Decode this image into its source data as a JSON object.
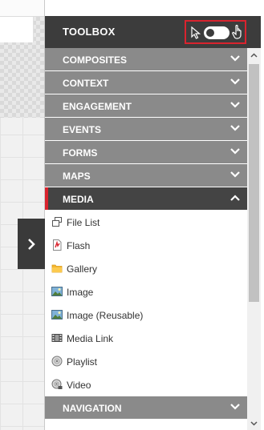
{
  "toolbox": {
    "title": "TOOLBOX",
    "groups_before": [
      {
        "label": "COMPOSITES"
      },
      {
        "label": "CONTEXT"
      },
      {
        "label": "ENGAGEMENT"
      },
      {
        "label": "EVENTS"
      },
      {
        "label": "FORMS"
      },
      {
        "label": "MAPS"
      }
    ],
    "active_group": {
      "label": "MEDIA"
    },
    "media_items": [
      {
        "label": "File List",
        "icon": "file-list-icon"
      },
      {
        "label": "Flash",
        "icon": "flash-file-icon"
      },
      {
        "label": "Gallery",
        "icon": "folder-icon"
      },
      {
        "label": "Image",
        "icon": "image-icon"
      },
      {
        "label": "Image (Reusable)",
        "icon": "image-reusable-icon"
      },
      {
        "label": "Media Link",
        "icon": "film-icon"
      },
      {
        "label": "Playlist",
        "icon": "playlist-disc-icon"
      },
      {
        "label": "Video",
        "icon": "video-disc-icon"
      }
    ],
    "groups_after": [
      {
        "label": "NAVIGATION"
      }
    ]
  },
  "colors": {
    "header_bg": "#3c3c3c",
    "group_bg": "#8a8a8a",
    "active_group_bg": "#444444",
    "accent_red": "#d9232e"
  }
}
